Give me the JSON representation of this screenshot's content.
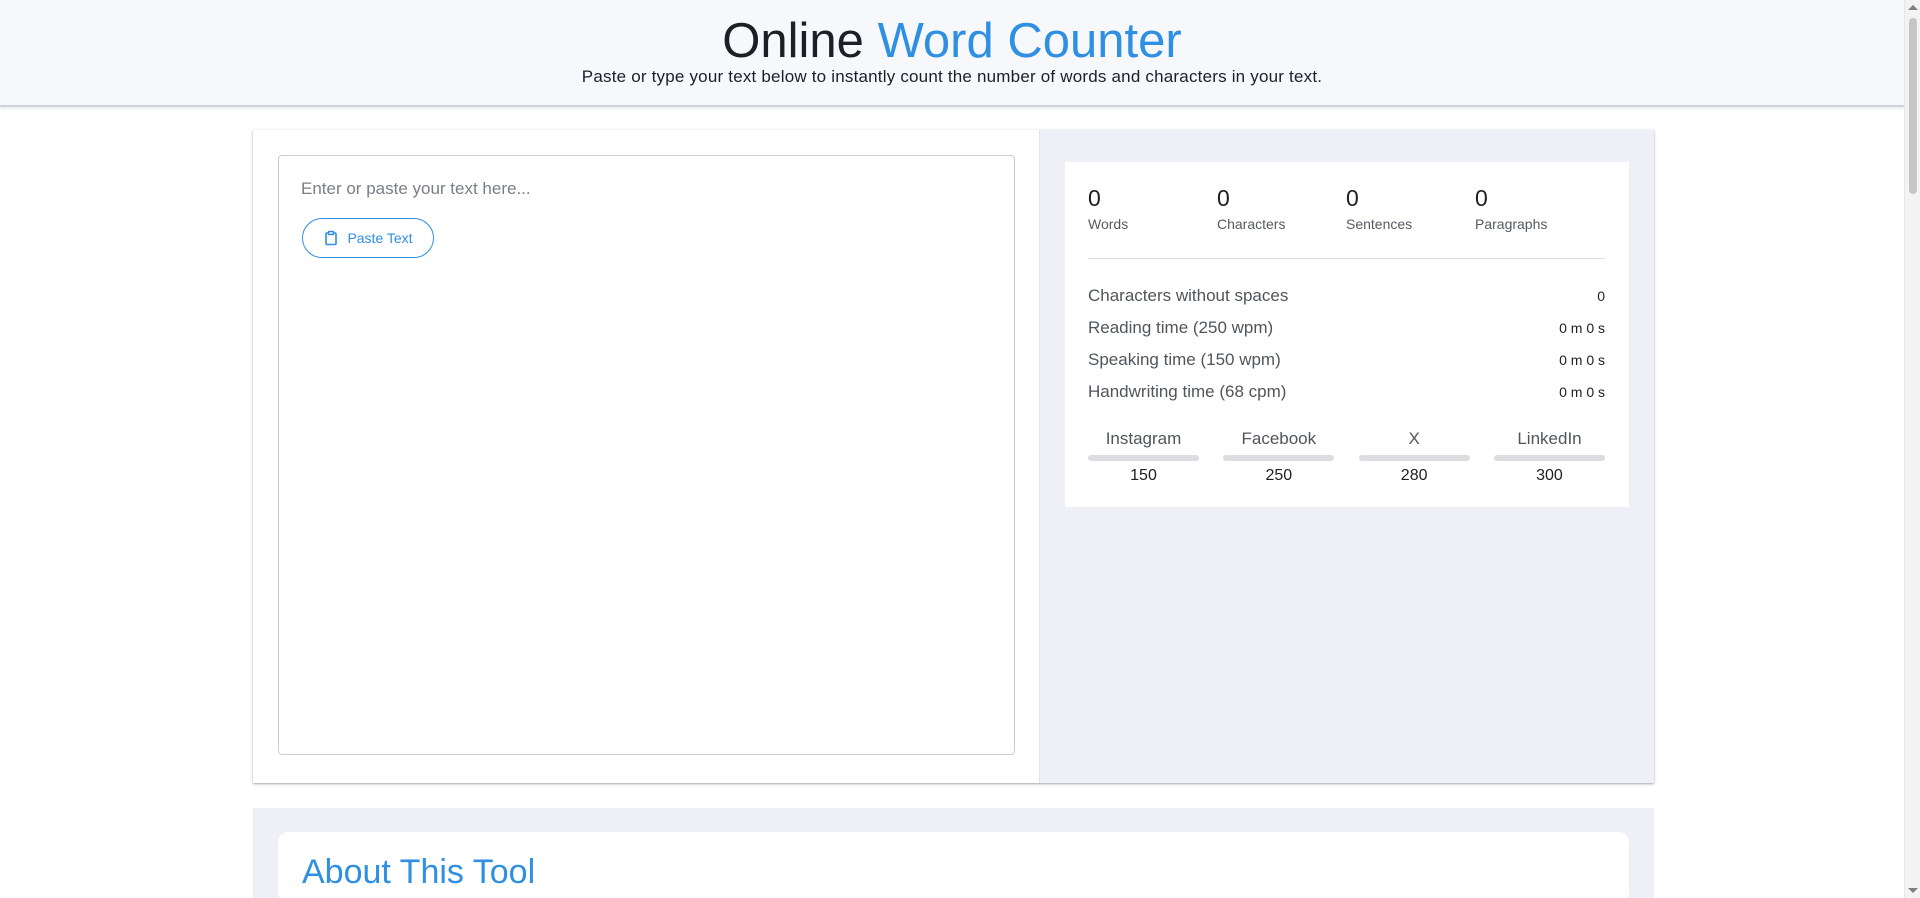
{
  "header": {
    "title_part1": "Online",
    "title_part2": "Word Counter",
    "subtitle": "Paste or type your text below to instantly count the number of words and characters in your text."
  },
  "editor": {
    "placeholder": "Enter or paste your text here...",
    "value": "",
    "paste_label": "Paste Text",
    "paste_icon": "clipboard-icon"
  },
  "counts": [
    {
      "value": "0",
      "label": "Words"
    },
    {
      "value": "0",
      "label": "Characters"
    },
    {
      "value": "0",
      "label": "Sentences"
    },
    {
      "value": "0",
      "label": "Paragraphs"
    }
  ],
  "metrics": [
    {
      "label": "Characters without spaces",
      "value": "0"
    },
    {
      "label": "Reading time (250 wpm)",
      "value": "0 m 0 s"
    },
    {
      "label": "Speaking time (150 wpm)",
      "value": "0 m 0 s"
    },
    {
      "label": "Handwriting time (68 cpm)",
      "value": "0 m 0 s"
    }
  ],
  "social": [
    {
      "name": "Instagram",
      "limit": "150",
      "progress": 0
    },
    {
      "name": "Facebook",
      "limit": "250",
      "progress": 0
    },
    {
      "name": "X",
      "limit": "280",
      "progress": 0
    },
    {
      "name": "LinkedIn",
      "limit": "300",
      "progress": 0
    }
  ],
  "about": {
    "title": "About This Tool"
  },
  "colors": {
    "accent": "#2f8fe3",
    "stats_background": "#eeeff7",
    "header_background": "#f6f8fc"
  }
}
